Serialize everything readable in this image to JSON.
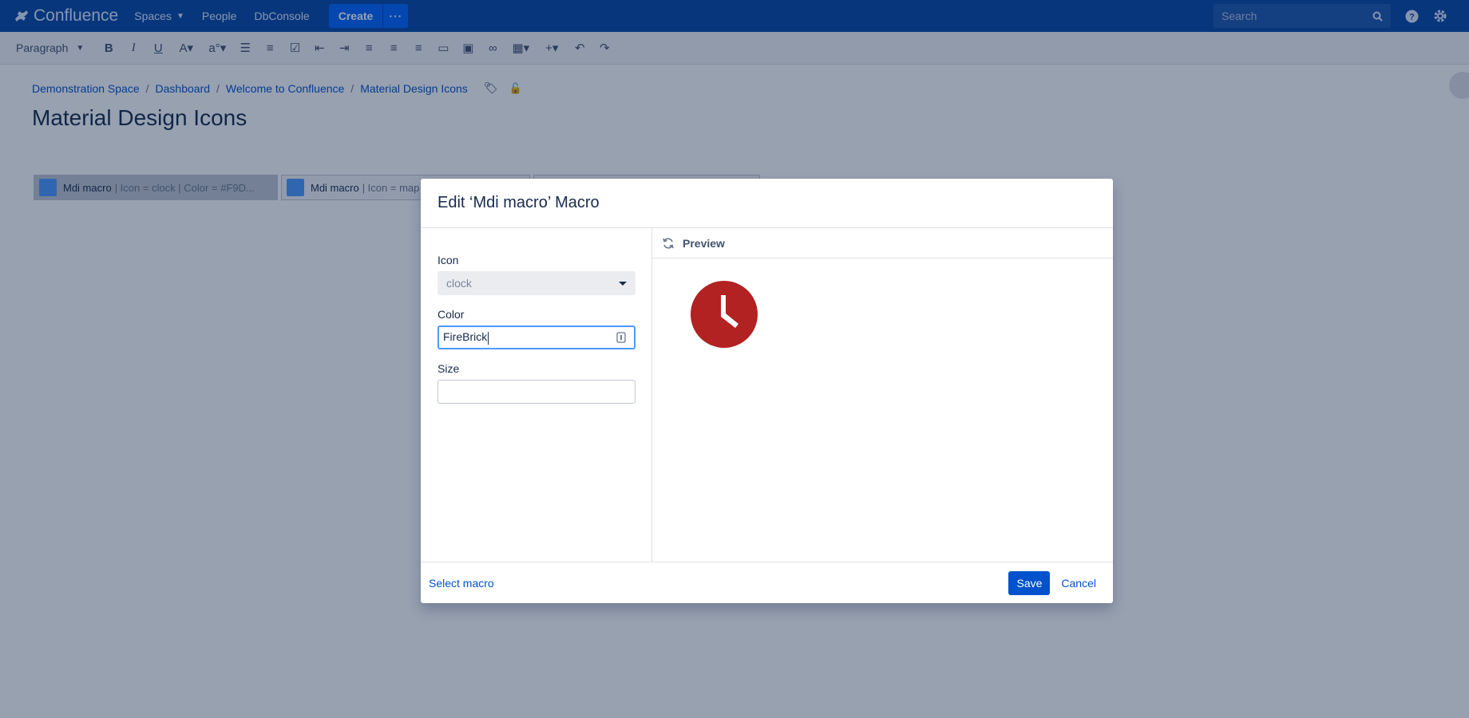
{
  "header": {
    "brand": "Confluence",
    "nav": [
      {
        "label": "Spaces"
      },
      {
        "label": "People"
      },
      {
        "label": "DbConsole"
      }
    ],
    "create_label": "Create",
    "more_label": "···",
    "search_placeholder": "Search"
  },
  "toolbar": {
    "paragraph_label": "Paragraph"
  },
  "breadcrumb": [
    "Demonstration Space",
    "Dashboard",
    "Welcome to Confluence",
    "Material Design Icons"
  ],
  "page_title": "Material Design Icons",
  "placeholders": [
    {
      "name": "Mdi macro",
      "params": "| Icon = clock | Color = #F9D..."
    },
    {
      "name": "Mdi macro",
      "params": "| Icon = map"
    },
    {
      "name": "",
      "params": ""
    }
  ],
  "dialog": {
    "title": "Edit ‘Mdi macro’ Macro",
    "icon_label": "Icon",
    "icon_value": "clock",
    "color_label": "Color",
    "color_value": "FireBrick",
    "size_label": "Size",
    "size_value": "",
    "preview_label": "Preview",
    "preview_icon_color": "#b22222",
    "select_macro_label": "Select macro",
    "save_label": "Save",
    "cancel_label": "Cancel"
  },
  "colors": {
    "header_bg": "#0747a6",
    "primary": "#0052cc",
    "firebrick": "#b22222"
  }
}
